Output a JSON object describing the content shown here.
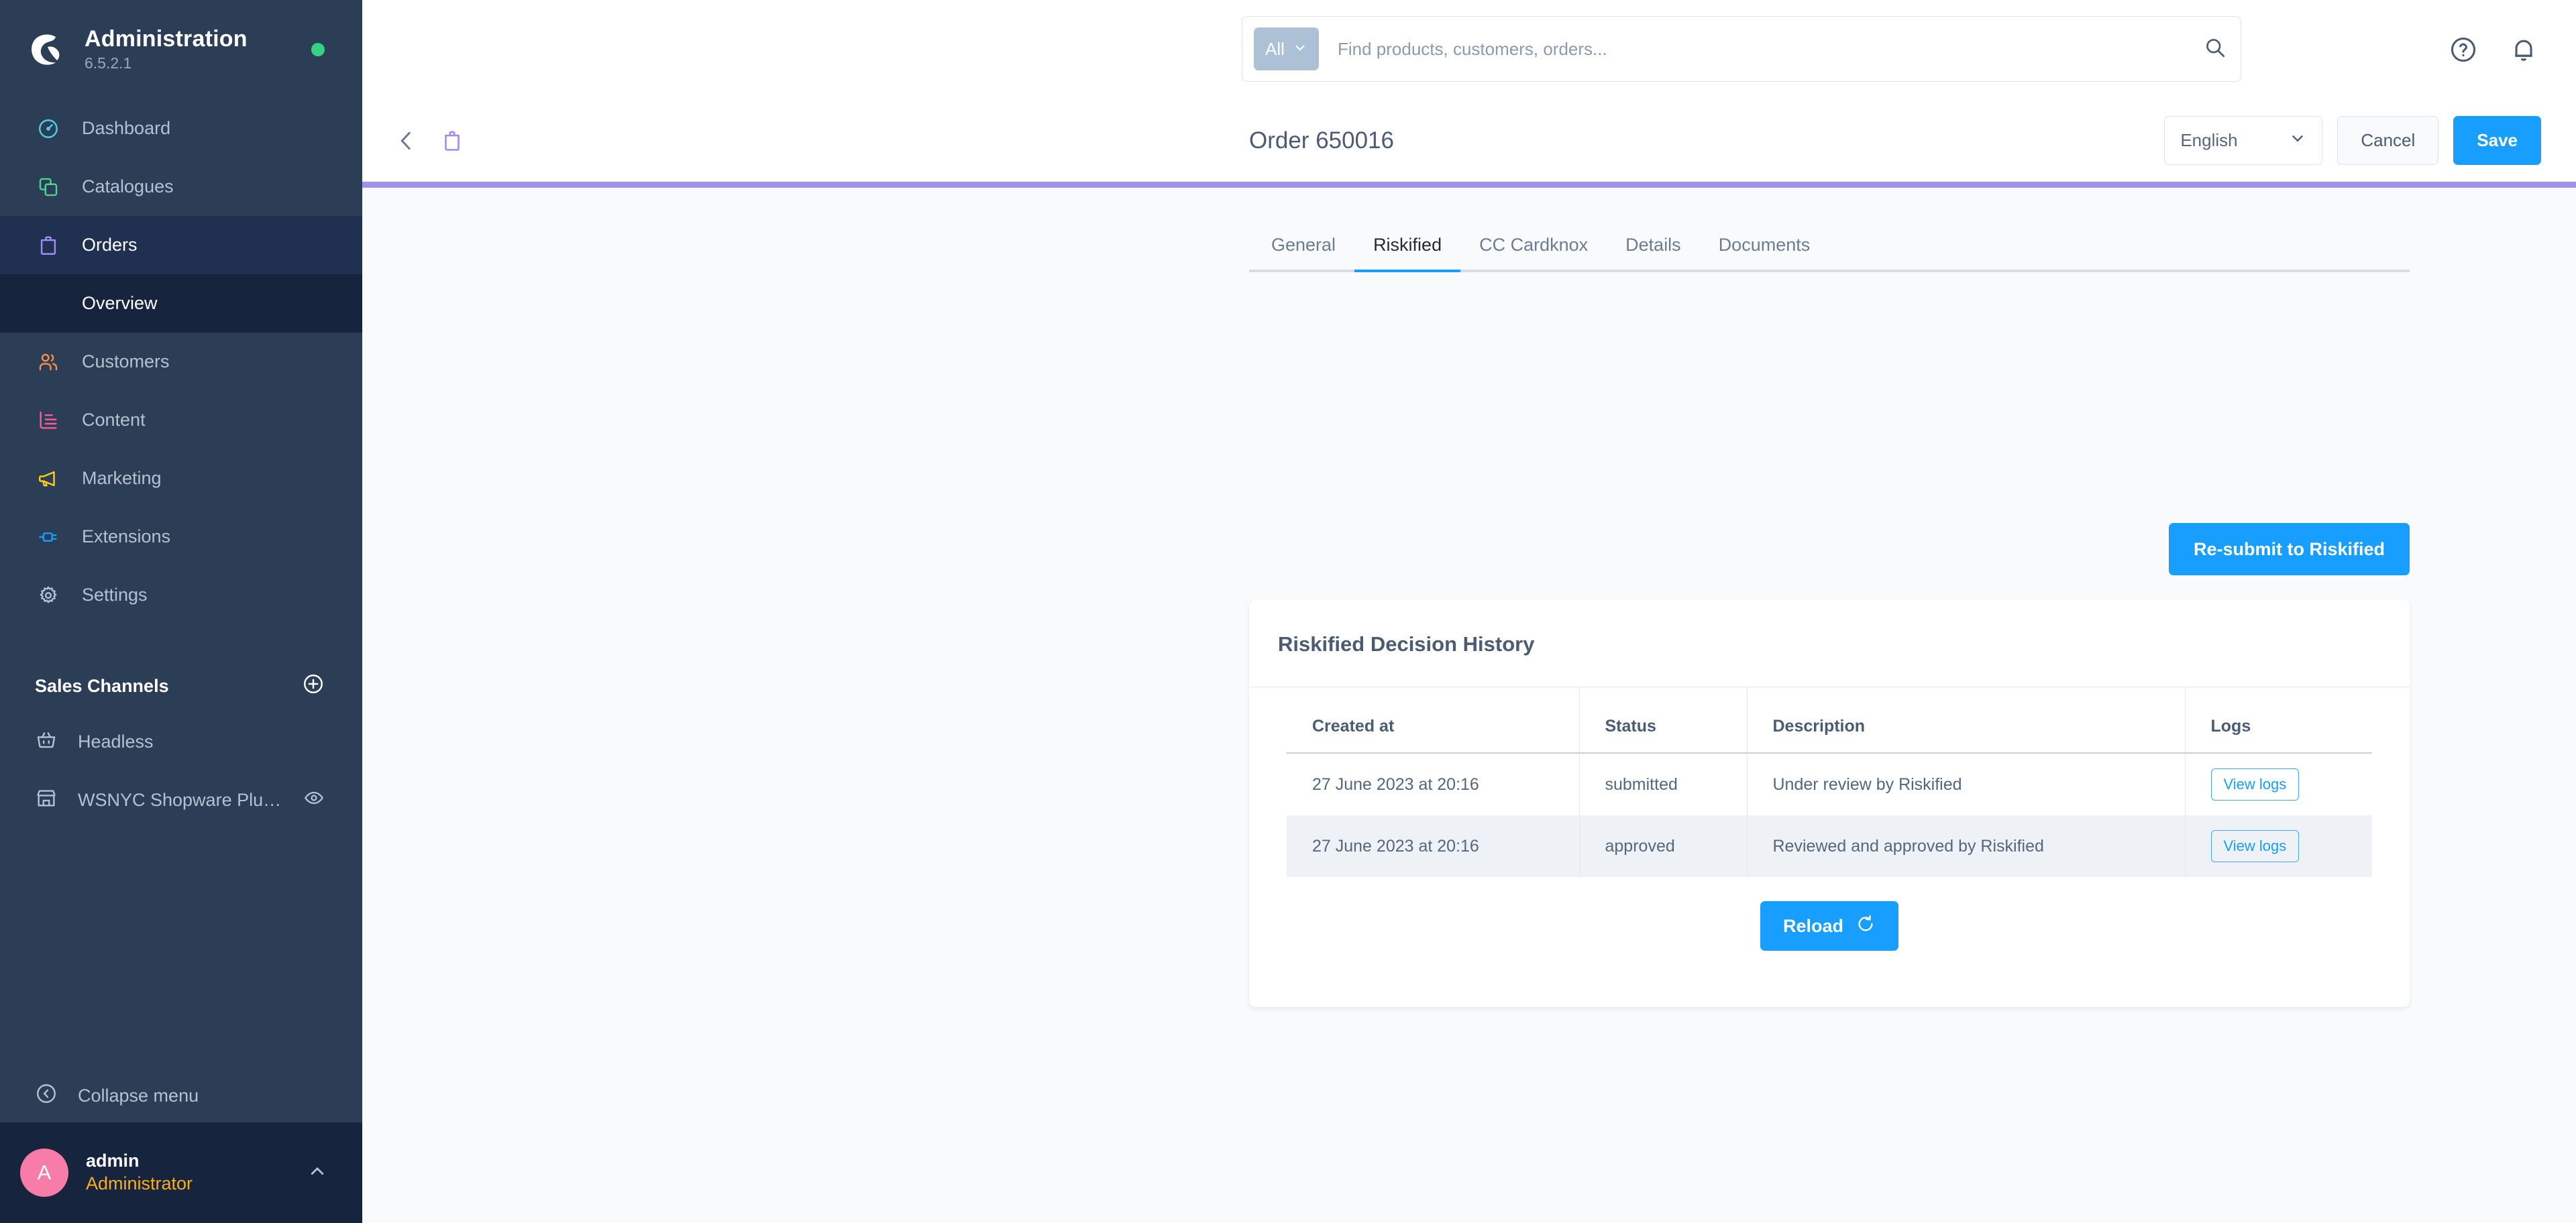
{
  "sidebar": {
    "brand": {
      "title": "Administration",
      "version": "6.5.2.1"
    },
    "nav": [
      {
        "label": "Dashboard",
        "icon": "gauge-icon",
        "color": "#4dd0e1"
      },
      {
        "label": "Catalogues",
        "icon": "copy-icon",
        "color": "#4fd394"
      },
      {
        "label": "Orders",
        "icon": "bag-icon",
        "color": "#a48df0"
      },
      {
        "label": "Customers",
        "icon": "users-icon",
        "color": "#ff8f47"
      },
      {
        "label": "Content",
        "icon": "content-icon",
        "color": "#ff5ba0"
      },
      {
        "label": "Marketing",
        "icon": "megaphone-icon",
        "color": "#ffd016"
      },
      {
        "label": "Extensions",
        "icon": "plug-icon",
        "color": "#199dff"
      },
      {
        "label": "Settings",
        "icon": "gear-icon",
        "color": "#b5c1d1"
      }
    ],
    "orders_sub": {
      "label": "Overview"
    },
    "sales_channels": {
      "heading": "Sales Channels",
      "items": [
        {
          "label": "Headless",
          "icon": "basket-icon"
        },
        {
          "label": "WSNYC Shopware Plugi...",
          "icon": "storefront-icon"
        }
      ]
    },
    "collapse": {
      "label": "Collapse menu"
    },
    "user": {
      "initial": "A",
      "name": "admin",
      "role": "Administrator"
    }
  },
  "topbar": {
    "search": {
      "scope": "All",
      "placeholder": "Find products, customers, orders...",
      "value": ""
    }
  },
  "header": {
    "title": "Order 650016",
    "language": "English",
    "cancel_label": "Cancel",
    "save_label": "Save"
  },
  "main": {
    "tabs": [
      {
        "label": "General",
        "active": false
      },
      {
        "label": "Riskified",
        "active": true
      },
      {
        "label": "CC Cardknox",
        "active": false
      },
      {
        "label": "Details",
        "active": false
      },
      {
        "label": "Documents",
        "active": false
      }
    ],
    "resubmit_label": "Re-submit to Riskified",
    "card": {
      "title": "Riskified Decision History",
      "columns": [
        "Created at",
        "Status",
        "Description",
        "Logs"
      ],
      "rows": [
        {
          "created_at": "27 June 2023 at 20:16",
          "status": "submitted",
          "description": "Under review by Riskified",
          "logs_label": "View logs"
        },
        {
          "created_at": "27 June 2023 at 20:16",
          "status": "approved",
          "description": "Reviewed and approved by Riskified",
          "logs_label": "View logs"
        }
      ],
      "reload_label": "Reload"
    }
  },
  "colors": {
    "accent_blue": "#189eff",
    "sidebar_bg": "#2b3e56",
    "sidebar_active": "#1f3050",
    "sidebar_sub_active": "#16243d",
    "progress_purple": "#a092e8",
    "status_dot_green": "#37d183",
    "avatar_pink": "#f87ca8",
    "role_orange": "#fbae17"
  }
}
